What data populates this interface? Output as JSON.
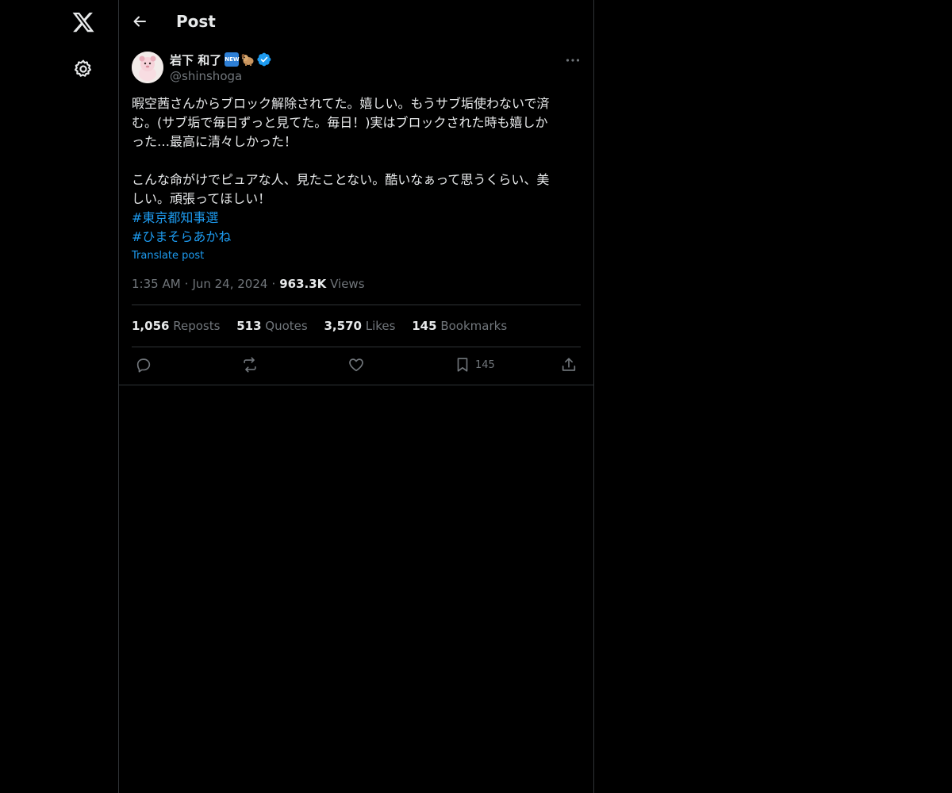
{
  "header": {
    "title": "Post"
  },
  "author": {
    "name": "岩下 和了",
    "new_badge": "NEW",
    "handle": "@shinshoga"
  },
  "post": {
    "text": "暇空茜さんからブロック解除されてた。嬉しい。もうサブ垢使わないで済\nむ。(サブ垢で毎日ずっと見てた。毎日！)実はブロックされた時も嬉しか\nった…最高に清々しかった！\n\nこんな命がけでピュアな人、見たことない。酷いなぁって思うくらい、美\nしい。頑張ってほしい！",
    "hashtags": [
      "#東京都知事選",
      "#ひまそらあかね"
    ],
    "translate_label": "Translate post",
    "time": "1:35 AM",
    "date": "Jun 24, 2024",
    "views_count": "963.3K",
    "views_label": "Views"
  },
  "stats": {
    "reposts_count": "1,056",
    "reposts_label": "Reposts",
    "quotes_count": "513",
    "quotes_label": "Quotes",
    "likes_count": "3,570",
    "likes_label": "Likes",
    "bookmarks_count": "145",
    "bookmarks_label": "Bookmarks"
  },
  "actions": {
    "bookmark_count": "145"
  },
  "icons": {
    "logo": "x-logo-icon",
    "settings": "gear-icon",
    "back": "arrow-left-icon",
    "more": "more-horizontal-icon",
    "verified": "verified-badge-icon",
    "reply": "reply-icon",
    "repost": "repost-icon",
    "like": "heart-icon",
    "bookmark": "bookmark-icon",
    "share": "share-icon"
  },
  "colors": {
    "background": "#000000",
    "text": "#e7e9ea",
    "muted": "#71767b",
    "accent": "#1d9bf0",
    "border": "#2f3336"
  }
}
